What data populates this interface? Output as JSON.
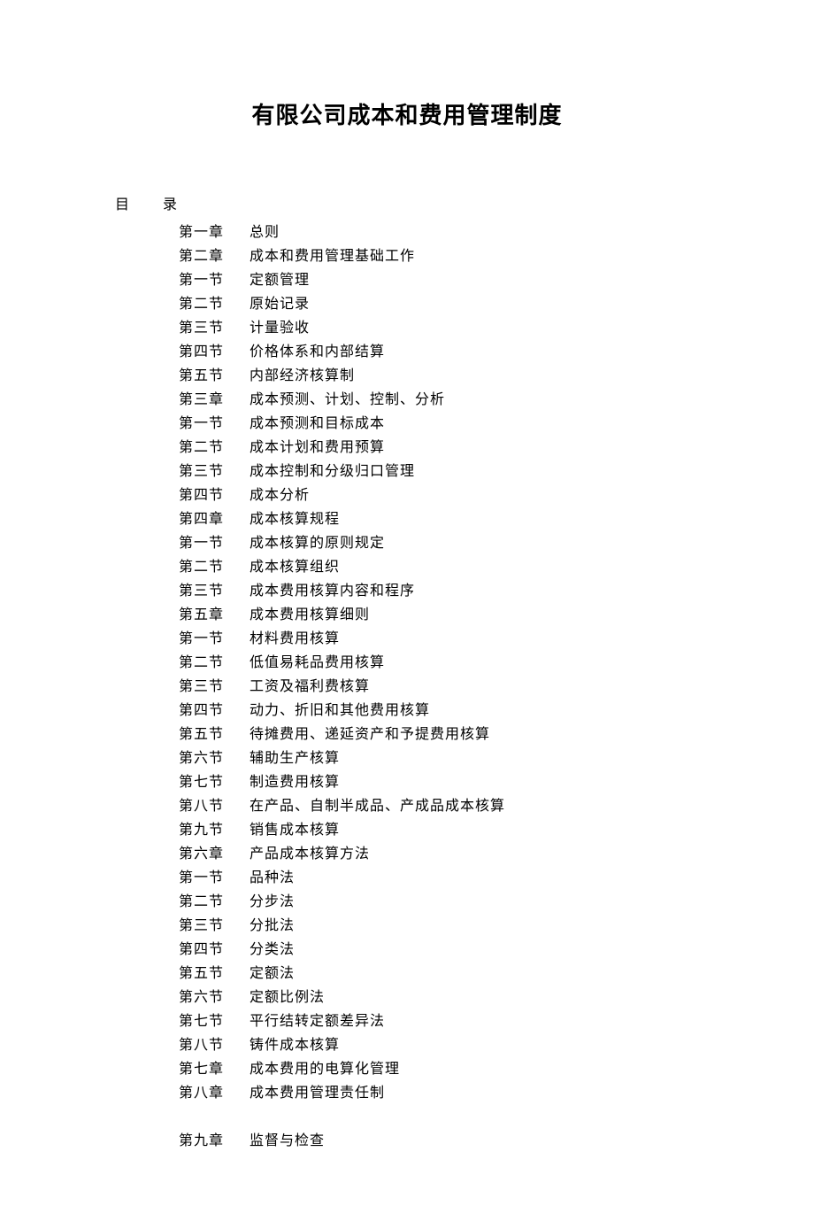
{
  "title": "有限公司成本和费用管理制度",
  "tocHeader": {
    "mu": "目",
    "lu": "录"
  },
  "entries": [
    {
      "label": "第一章",
      "text": "总则"
    },
    {
      "label": "第二章",
      "text": "成本和费用管理基础工作"
    },
    {
      "label": "第一节",
      "text": "定额管理"
    },
    {
      "label": "第二节",
      "text": "原始记录"
    },
    {
      "label": "第三节",
      "text": "计量验收"
    },
    {
      "label": "第四节",
      "text": "价格体系和内部结算"
    },
    {
      "label": "第五节",
      "text": "内部经济核算制"
    },
    {
      "label": "第三章",
      "text": "成本预测、计划、控制、分析"
    },
    {
      "label": "第一节",
      "text": "成本预测和目标成本"
    },
    {
      "label": "第二节",
      "text": "成本计划和费用预算"
    },
    {
      "label": "第三节",
      "text": "成本控制和分级归口管理"
    },
    {
      "label": "第四节",
      "text": "成本分析"
    },
    {
      "label": "第四章",
      "text": "成本核算规程"
    },
    {
      "label": "第一节",
      "text": "成本核算的原则规定"
    },
    {
      "label": "第二节",
      "text": "成本核算组织"
    },
    {
      "label": "第三节",
      "text": "成本费用核算内容和程序"
    },
    {
      "label": "第五章",
      "text": "成本费用核算细则"
    },
    {
      "label": "第一节",
      "text": "材料费用核算"
    },
    {
      "label": "第二节",
      "text": "低值易耗品费用核算"
    },
    {
      "label": "第三节",
      "text": "工资及福利费核算"
    },
    {
      "label": "第四节",
      "text": "动力、折旧和其他费用核算"
    },
    {
      "label": "第五节",
      "text": "待摊费用、递延资产和予提费用核算"
    },
    {
      "label": "第六节",
      "text": "辅助生产核算"
    },
    {
      "label": "第七节",
      "text": "制造费用核算"
    },
    {
      "label": "第八节",
      "text": "在产品、自制半成品、产成品成本核算"
    },
    {
      "label": "第九节",
      "text": "销售成本核算"
    },
    {
      "label": "第六章",
      "text": "产品成本核算方法"
    },
    {
      "label": "第一节",
      "text": "品种法"
    },
    {
      "label": "第二节",
      "text": "分步法"
    },
    {
      "label": "第三节",
      "text": "分批法"
    },
    {
      "label": "第四节",
      "text": "分类法"
    },
    {
      "label": "第五节",
      "text": "定额法"
    },
    {
      "label": "第六节",
      "text": "定额比例法"
    },
    {
      "label": "第七节",
      "text": "平行结转定额差异法"
    },
    {
      "label": "第八节",
      "text": "铸件成本核算"
    },
    {
      "label": "第七章",
      "text": "成本费用的电算化管理"
    },
    {
      "label": "第八章",
      "text": "成本费用管理责任制"
    },
    {
      "gap": true
    },
    {
      "label": "第九章",
      "text": "监督与检查"
    }
  ]
}
